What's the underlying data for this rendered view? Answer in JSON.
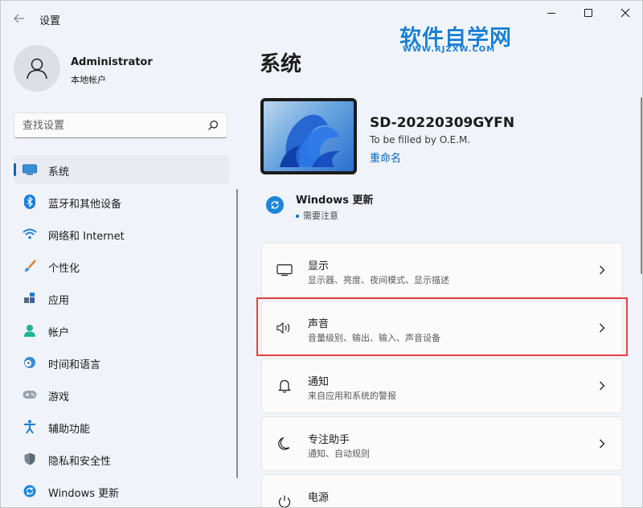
{
  "window": {
    "app_title": "设置"
  },
  "watermark": {
    "main": "软件自学网",
    "url": "WWW.RJZXW.COM"
  },
  "user": {
    "name": "Administrator",
    "account_type": "本地帐户"
  },
  "search": {
    "placeholder": "查找设置"
  },
  "sidebar": {
    "items": [
      {
        "label": "系统",
        "icon": "monitor-icon",
        "active": true
      },
      {
        "label": "蓝牙和其他设备",
        "icon": "bluetooth-icon"
      },
      {
        "label": "网络和 Internet",
        "icon": "wifi-icon"
      },
      {
        "label": "个性化",
        "icon": "brush-icon"
      },
      {
        "label": "应用",
        "icon": "apps-icon"
      },
      {
        "label": "帐户",
        "icon": "person-icon"
      },
      {
        "label": "时间和语言",
        "icon": "clock-globe-icon"
      },
      {
        "label": "游戏",
        "icon": "gamepad-icon"
      },
      {
        "label": "辅助功能",
        "icon": "accessibility-icon"
      },
      {
        "label": "隐私和安全性",
        "icon": "shield-icon"
      },
      {
        "label": "Windows 更新",
        "icon": "update-icon"
      }
    ]
  },
  "main": {
    "title": "系统",
    "device": {
      "name": "SD-20220309GYFN",
      "model": "To be filled by O.E.M.",
      "rename": "重命名"
    },
    "update": {
      "title": "Windows 更新",
      "status": "需要注意"
    },
    "cards": [
      {
        "title": "显示",
        "subtitle": "显示器、亮度、夜间模式、显示描述",
        "icon": "display-icon"
      },
      {
        "title": "声音",
        "subtitle": "音量级别、输出、输入、声音设备",
        "icon": "speaker-icon"
      },
      {
        "title": "通知",
        "subtitle": "来自应用和系统的警报",
        "icon": "bell-icon"
      },
      {
        "title": "专注助手",
        "subtitle": "通知、自动规则",
        "icon": "moon-icon"
      },
      {
        "title": "电源",
        "subtitle": "",
        "icon": "power-icon"
      }
    ]
  },
  "colors": {
    "accent": "#0067c0",
    "highlight_box": "#e8403f",
    "watermark": "#1a7fd4"
  }
}
